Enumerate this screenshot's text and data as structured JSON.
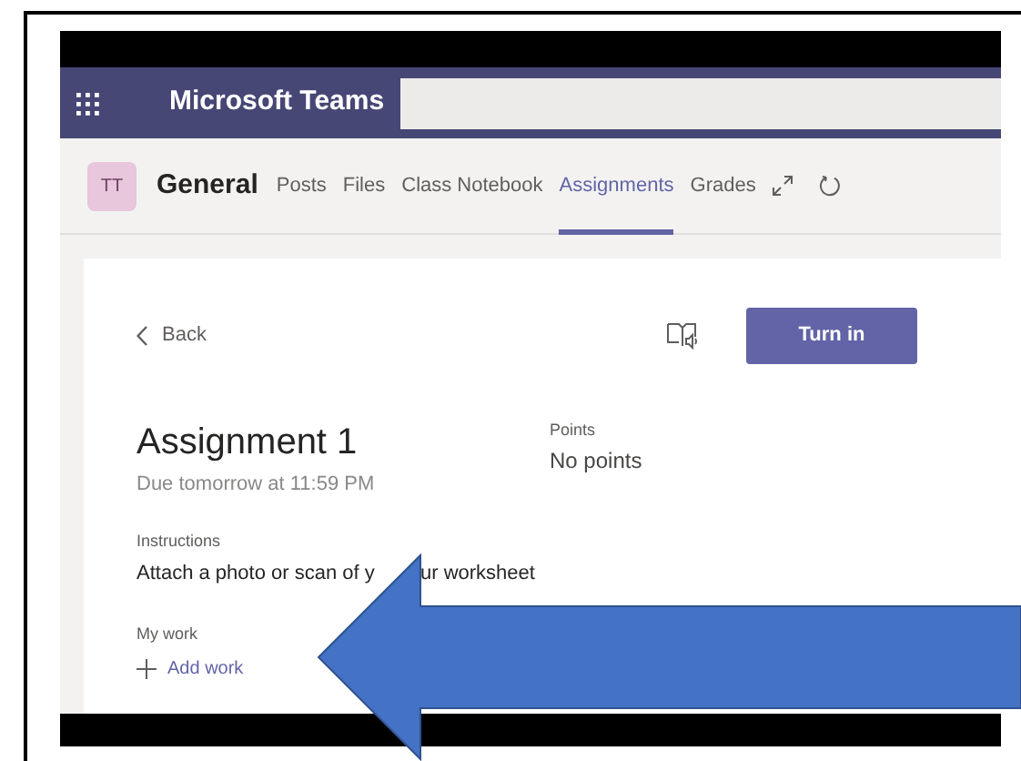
{
  "app_bar": {
    "title": "Microsoft Teams"
  },
  "channel": {
    "avatar": "TT",
    "name": "General"
  },
  "tabs": [
    {
      "label": "Posts",
      "selected": false
    },
    {
      "label": "Files",
      "selected": false
    },
    {
      "label": "Class Notebook",
      "selected": false
    },
    {
      "label": "Assignments",
      "selected": true
    },
    {
      "label": "Grades",
      "selected": false
    }
  ],
  "assignment": {
    "back": "Back",
    "turn_in": "Turn in",
    "title": "Assignment 1",
    "due": "Due tomorrow at 11:59 PM",
    "points_label": "Points",
    "points_value": "No points",
    "instructions_label": "Instructions",
    "instructions": [
      "Attach a photo or scan of y",
      "ur worksheet"
    ],
    "my_work_label": "My work",
    "add_work": "Add work"
  }
}
